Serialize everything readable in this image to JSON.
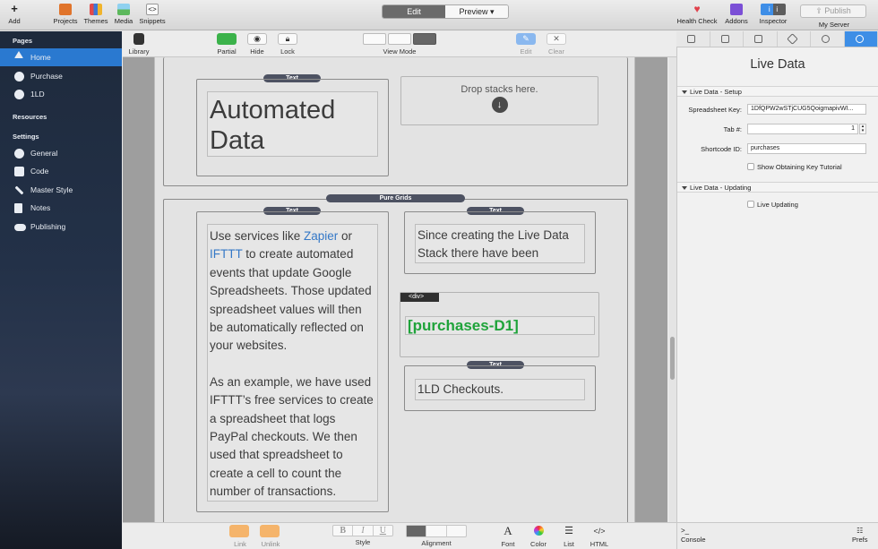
{
  "toolbar": {
    "add": "Add",
    "projects": "Projects",
    "themes": "Themes",
    "media": "Media",
    "snippets": "Snippets",
    "edit": "Edit",
    "preview": "Preview",
    "health_check": "Health Check",
    "addons": "Addons",
    "inspector": "Inspector",
    "publish": "Publish",
    "my_server": "My Server"
  },
  "sidebar": {
    "pages_header": "Pages",
    "pages": [
      "Home",
      "Purchase",
      "1LD"
    ],
    "resources_header": "Resources",
    "settings_header": "Settings",
    "settings": [
      "General",
      "Code",
      "Master Style",
      "Notes",
      "Publishing"
    ]
  },
  "toolbar2": {
    "library": "Library",
    "partial": "Partial",
    "hide": "Hide",
    "lock": "Lock",
    "view_mode": "View Mode",
    "edit": "Edit",
    "clear": "Clear"
  },
  "canvas": {
    "text_label": "Text",
    "automated_data": "Automated Data",
    "drop_stacks": "Drop stacks here.",
    "pure_grids": "Pure Grids",
    "para1_pre": "Use services like ",
    "link_zapier": "Zapier",
    "para1_or": " or ",
    "link_ifttt": "IFTTT",
    "para1_post": " to create automated events that update Google Spreadsheets. Those updated spreadsheet values will then be automatically reflected on your websites.",
    "para2": "As an example, we have used IFTTT’s free services to create a spreadsheet that logs PayPal checkouts. We then used that spreadsheet to create a cell to count the number of transactions.",
    "since_text": "Since creating the Live Data Stack there have been",
    "div_label": "<div>",
    "shortcode": "[purchases-D1]",
    "checkouts": "1LD Checkouts."
  },
  "bottombar": {
    "link": "Link",
    "unlink": "Unlink",
    "style": "Style",
    "bold": "B",
    "italic": "I",
    "underline": "U",
    "alignment": "Alignment",
    "font": "Font",
    "color": "Color",
    "list": "List",
    "html": "HTML",
    "console": "Console",
    "prefs": "Prefs"
  },
  "right_panel": {
    "title": "Live Data",
    "section_setup": "Live Data - Setup",
    "spreadsheet_key_label": "Spreadsheet Key:",
    "spreadsheet_key_value": "1DfQPW2wSTjCUG5QoigmapivWI...",
    "tab_label": "Tab #:",
    "tab_value": "1",
    "shortcode_label": "Shortcode ID:",
    "shortcode_value": "purchases",
    "show_tutorial": "Show Obtaining Key Tutorial",
    "section_updating": "Live Data - Updating",
    "live_updating": "Live Updating"
  },
  "colors": {
    "accent": "#2a79d0",
    "shortcode_green": "#1fa33a",
    "link_blue": "#3478c7"
  }
}
